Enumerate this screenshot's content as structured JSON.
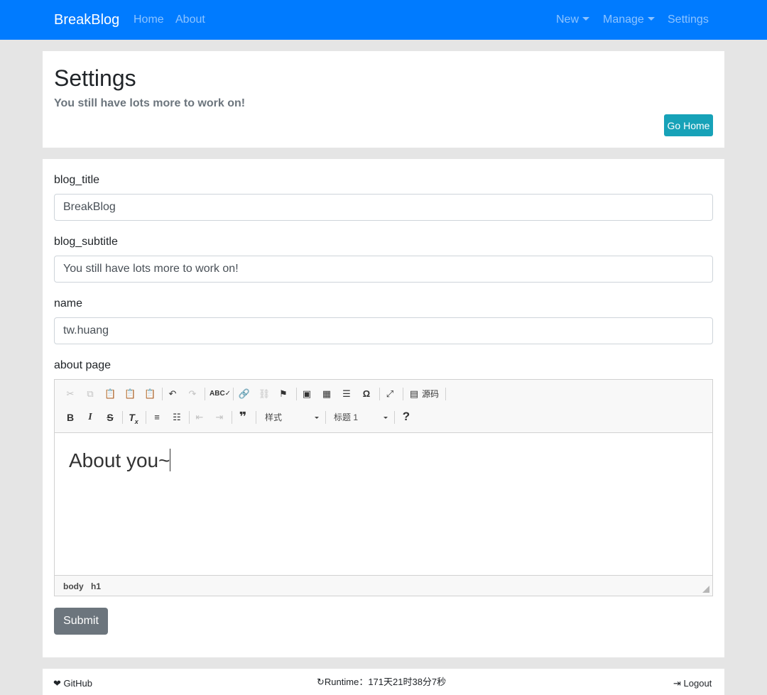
{
  "navbar": {
    "brand": "BreakBlog",
    "left_links": [
      "Home",
      "About"
    ],
    "right_links": [
      "New",
      "Manage",
      "Settings"
    ]
  },
  "header": {
    "title": "Settings",
    "subtitle": "You still have lots more to work on!",
    "go_home": "Go Home"
  },
  "form": {
    "fields": [
      {
        "label": "blog_title",
        "value": "BreakBlog"
      },
      {
        "label": "blog_subtitle",
        "value": "You still have lots more to work on!"
      },
      {
        "label": "name",
        "value": "tw.huang"
      }
    ],
    "about_label": "about page",
    "submit": "Submit"
  },
  "editor": {
    "toolbar": {
      "source_label": "源码",
      "styles_combo": "样式",
      "format_combo": "标题 1",
      "help": "?"
    },
    "content": "About you~",
    "path": [
      "body",
      "h1"
    ]
  },
  "footer": {
    "github": "GitHub",
    "runtime": "Runtime：171天21时38分7秒",
    "logout": "Logout"
  },
  "colors": {
    "primary": "#007bff",
    "info": "#17a2b8",
    "secondary": "#6c757d"
  }
}
